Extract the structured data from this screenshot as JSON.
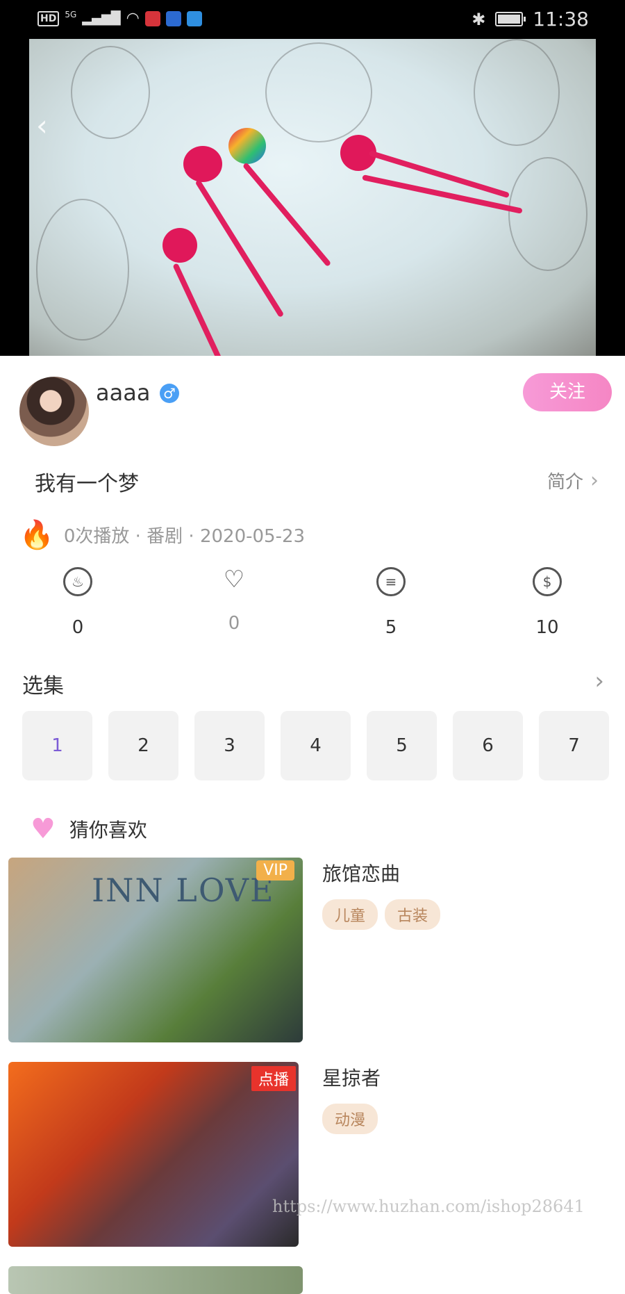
{
  "status_bar": {
    "left_labels": [
      "HD",
      "5G"
    ],
    "time": "11:38"
  },
  "author": {
    "name": "aaaa",
    "gender_icon": "male-icon",
    "follow_label": "关注"
  },
  "video_info": {
    "title": "我有一个梦",
    "intro_label": "简介",
    "meta": "0次播放 · 番剧 ·  2020-05-23"
  },
  "stats": [
    {
      "icon": "flame-icon",
      "value": "0"
    },
    {
      "icon": "heart-outline-icon",
      "value": "0"
    },
    {
      "icon": "comment-icon",
      "value": "5"
    },
    {
      "icon": "dollar-icon",
      "value": "10"
    }
  ],
  "episodes": {
    "title": "选集",
    "items": [
      "1",
      "2",
      "3",
      "4",
      "5",
      "6",
      "7"
    ],
    "active": "1"
  },
  "recommend": {
    "title": "猜你喜欢",
    "items": [
      {
        "title": "旅馆恋曲",
        "badge": "VIP",
        "tags": [
          "儿童",
          "古装"
        ],
        "cover_text": "INN LOVE"
      },
      {
        "title": "星掠者",
        "badge": "点播",
        "tags": [
          "动漫"
        ]
      }
    ]
  },
  "watermark": "https://www.huzhan.com/ishop28641",
  "colors": {
    "accent_pink": "#f79ad7",
    "active_episode": "#7c5cd6",
    "tag_bg": "#f7e6d6",
    "tag_text": "#b8865d"
  }
}
